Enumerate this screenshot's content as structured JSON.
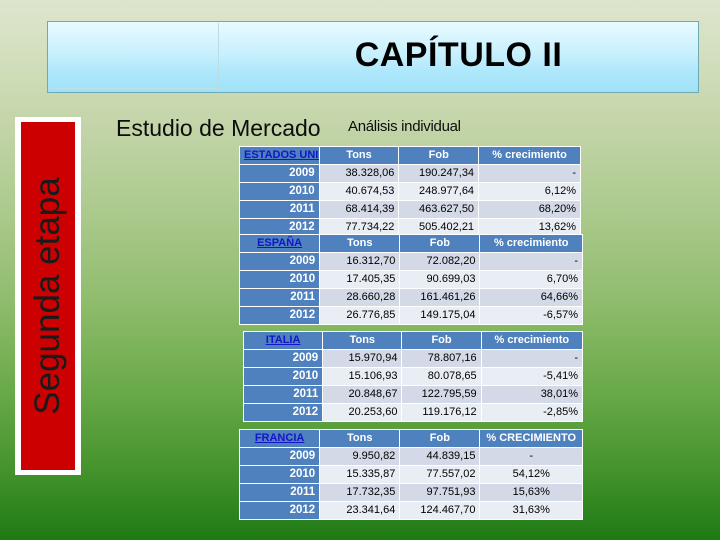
{
  "slide": {
    "title": "CAPÍTULO II",
    "heading_main": "Estudio de Mercado",
    "heading_sub": "Análisis individual",
    "side_banner": "Segunda etapa",
    "colors": {
      "banner_red": "#cc0000",
      "table_header_blue": "#4e81bd",
      "title_bar_blue": "#c8f0fd",
      "background_green_top": "#dee5cd",
      "background_green_bottom": "#1f7a14"
    }
  },
  "tables": [
    {
      "id": "usa",
      "country": "ESTADOS UNIDOS",
      "columns": [
        "Tons",
        "Fob",
        "% crecimiento"
      ],
      "pct_align": "right",
      "rows": [
        {
          "year": "2009",
          "tons": "38.328,06",
          "fob": "190.247,34",
          "pct": "-"
        },
        {
          "year": "2010",
          "tons": "40.674,53",
          "fob": "248.977,64",
          "pct": "6,12%"
        },
        {
          "year": "2011",
          "tons": "68.414,39",
          "fob": "463.627,50",
          "pct": "68,20%"
        },
        {
          "year": "2012",
          "tons": "77.734,22",
          "fob": "505.402,21",
          "pct": "13,62%"
        }
      ]
    },
    {
      "id": "esp",
      "country": "ESPAÑA",
      "columns": [
        "Tons",
        "Fob",
        "% crecimiento"
      ],
      "pct_align": "right",
      "rows": [
        {
          "year": "2009",
          "tons": "16.312,70",
          "fob": "72.082,20",
          "pct": "-"
        },
        {
          "year": "2010",
          "tons": "17.405,35",
          "fob": "90.699,03",
          "pct": "6,70%"
        },
        {
          "year": "2011",
          "tons": "28.660,28",
          "fob": "161.461,26",
          "pct": "64,66%"
        },
        {
          "year": "2012",
          "tons": "26.776,85",
          "fob": "149.175,04",
          "pct": "-6,57%"
        }
      ]
    },
    {
      "id": "ita",
      "country": "ITALIA",
      "columns": [
        "Tons",
        "Fob",
        "% crecimiento"
      ],
      "pct_align": "right",
      "rows": [
        {
          "year": "2009",
          "tons": "15.970,94",
          "fob": "78.807,16",
          "pct": "-"
        },
        {
          "year": "2010",
          "tons": "15.106,93",
          "fob": "80.078,65",
          "pct": "-5,41%"
        },
        {
          "year": "2011",
          "tons": "20.848,67",
          "fob": "122.795,59",
          "pct": "38,01%"
        },
        {
          "year": "2012",
          "tons": "20.253,60",
          "fob": "119.176,12",
          "pct": "-2,85%"
        }
      ]
    },
    {
      "id": "fra",
      "country": "FRANCIA",
      "columns": [
        "Tons",
        "Fob",
        "% CRECIMIENTO"
      ],
      "pct_align": "center",
      "rows": [
        {
          "year": "2009",
          "tons": "9.950,82",
          "fob": "44.839,15",
          "pct": "-"
        },
        {
          "year": "2010",
          "tons": "15.335,87",
          "fob": "77.557,02",
          "pct": "54,12%"
        },
        {
          "year": "2011",
          "tons": "17.732,35",
          "fob": "97.751,93",
          "pct": "15,63%"
        },
        {
          "year": "2012",
          "tons": "23.341,64",
          "fob": "124.467,70",
          "pct": "31,63%"
        }
      ]
    }
  ]
}
